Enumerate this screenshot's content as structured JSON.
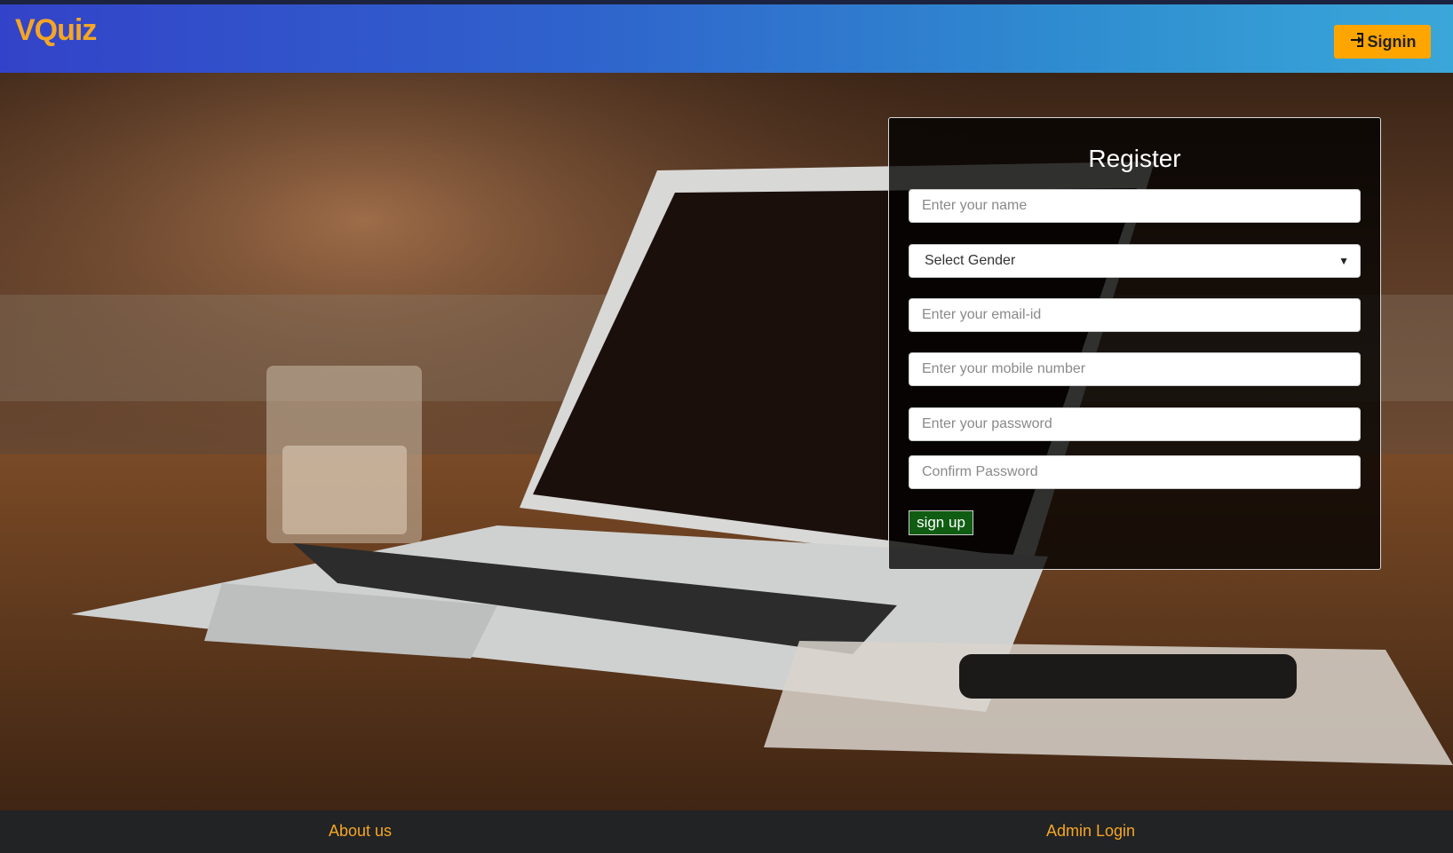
{
  "brand": {
    "name": "VQuiz"
  },
  "nav": {
    "signin_label": "Signin"
  },
  "register": {
    "title": "Register",
    "fields": {
      "name_placeholder": "Enter your name",
      "gender_selected": "Select Gender",
      "email_placeholder": "Enter your email-id",
      "mobile_placeholder": "Enter your mobile number",
      "password_placeholder": "Enter your password",
      "confirm_placeholder": "Confirm Password"
    },
    "submit_label": "sign up"
  },
  "footer": {
    "about_label": "About us",
    "admin_label": "Admin Login"
  },
  "colors": {
    "brand": "#f5a623",
    "signin_button": "#ffa500",
    "signup_button": "#0f5c12"
  },
  "icons": {
    "signin": "sign-in-arrow-icon",
    "select": "chevron-down-icon"
  }
}
